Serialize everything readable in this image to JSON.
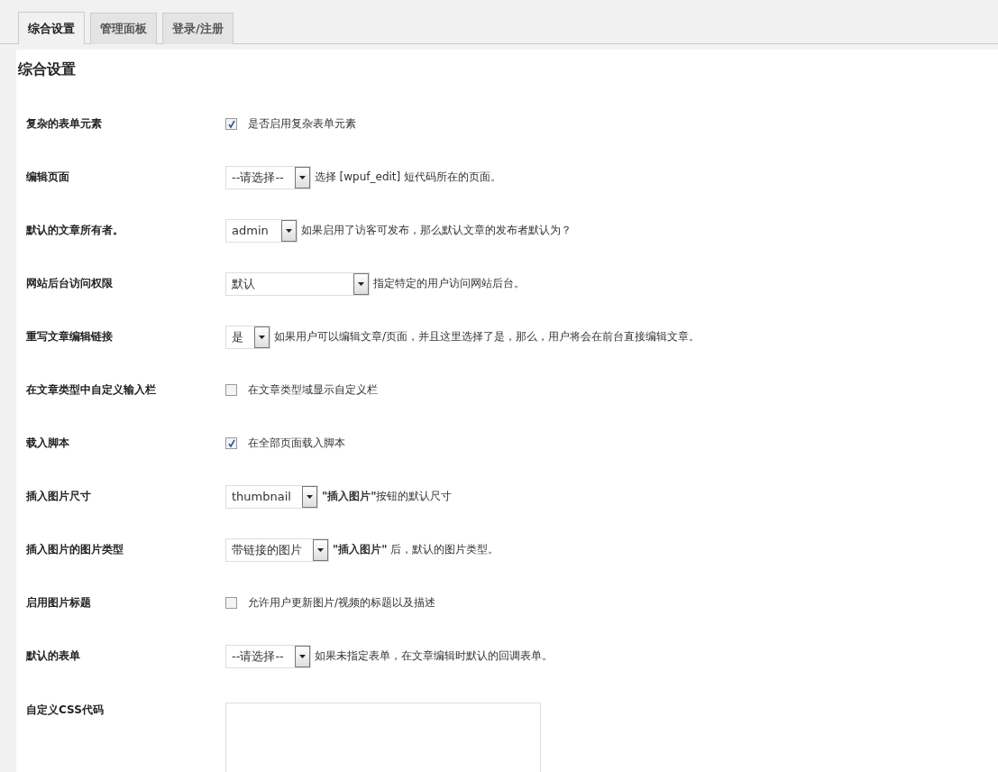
{
  "tabs": [
    {
      "label": "综合设置",
      "selected": true
    },
    {
      "label": "管理面板",
      "selected": false
    },
    {
      "label": "登录/注册",
      "selected": false
    }
  ],
  "section_title": "综合设置",
  "settings": [
    {
      "label": "复杂的表单元素",
      "kind": "checkbox",
      "checked": true,
      "description": "是否启用复杂表单元素"
    },
    {
      "label": "编辑页面",
      "kind": "select",
      "value": "--请选择--",
      "description": "选择 [wpuf_edit] 短代码所在的页面。"
    },
    {
      "label": "默认的文章所有者。",
      "kind": "select",
      "value": "admin",
      "description": "如果启用了访客可发布，那么默认文章的发布者默认为？"
    },
    {
      "label": "网站后台访问权限",
      "kind": "select",
      "value": "默认",
      "description": "指定特定的用户访问网站后台。"
    },
    {
      "label": "重写文章编辑链接",
      "kind": "select",
      "value": "是",
      "description": "如果用户可以编辑文章/页面，并且这里选择了是，那么，用户将会在前台直接编辑文章。"
    },
    {
      "label": "在文章类型中自定义输入栏",
      "kind": "checkbox",
      "checked": false,
      "description": "在文章类型域显示自定义栏"
    },
    {
      "label": "载入脚本",
      "kind": "checkbox",
      "checked": true,
      "description": "在全部页面载入脚本"
    },
    {
      "label": "插入图片尺寸",
      "kind": "select",
      "value": "thumbnail",
      "description": "**\"插入图片\"**按钮的默认尺寸"
    },
    {
      "label": "插入图片的图片类型",
      "kind": "select",
      "value": "带链接的图片",
      "description": "**\"插入图片\"** 后，默认的图片类型。"
    },
    {
      "label": "启用图片标题",
      "kind": "checkbox",
      "checked": false,
      "description": "允许用户更新图片/视频的标题以及描述"
    },
    {
      "label": "默认的表单",
      "kind": "select",
      "value": "--请选择--",
      "description": "如果未指定表单，在文章编辑时默认的回调表单。"
    },
    {
      "label": "自定义CSS代码",
      "kind": "textarea"
    }
  ]
}
